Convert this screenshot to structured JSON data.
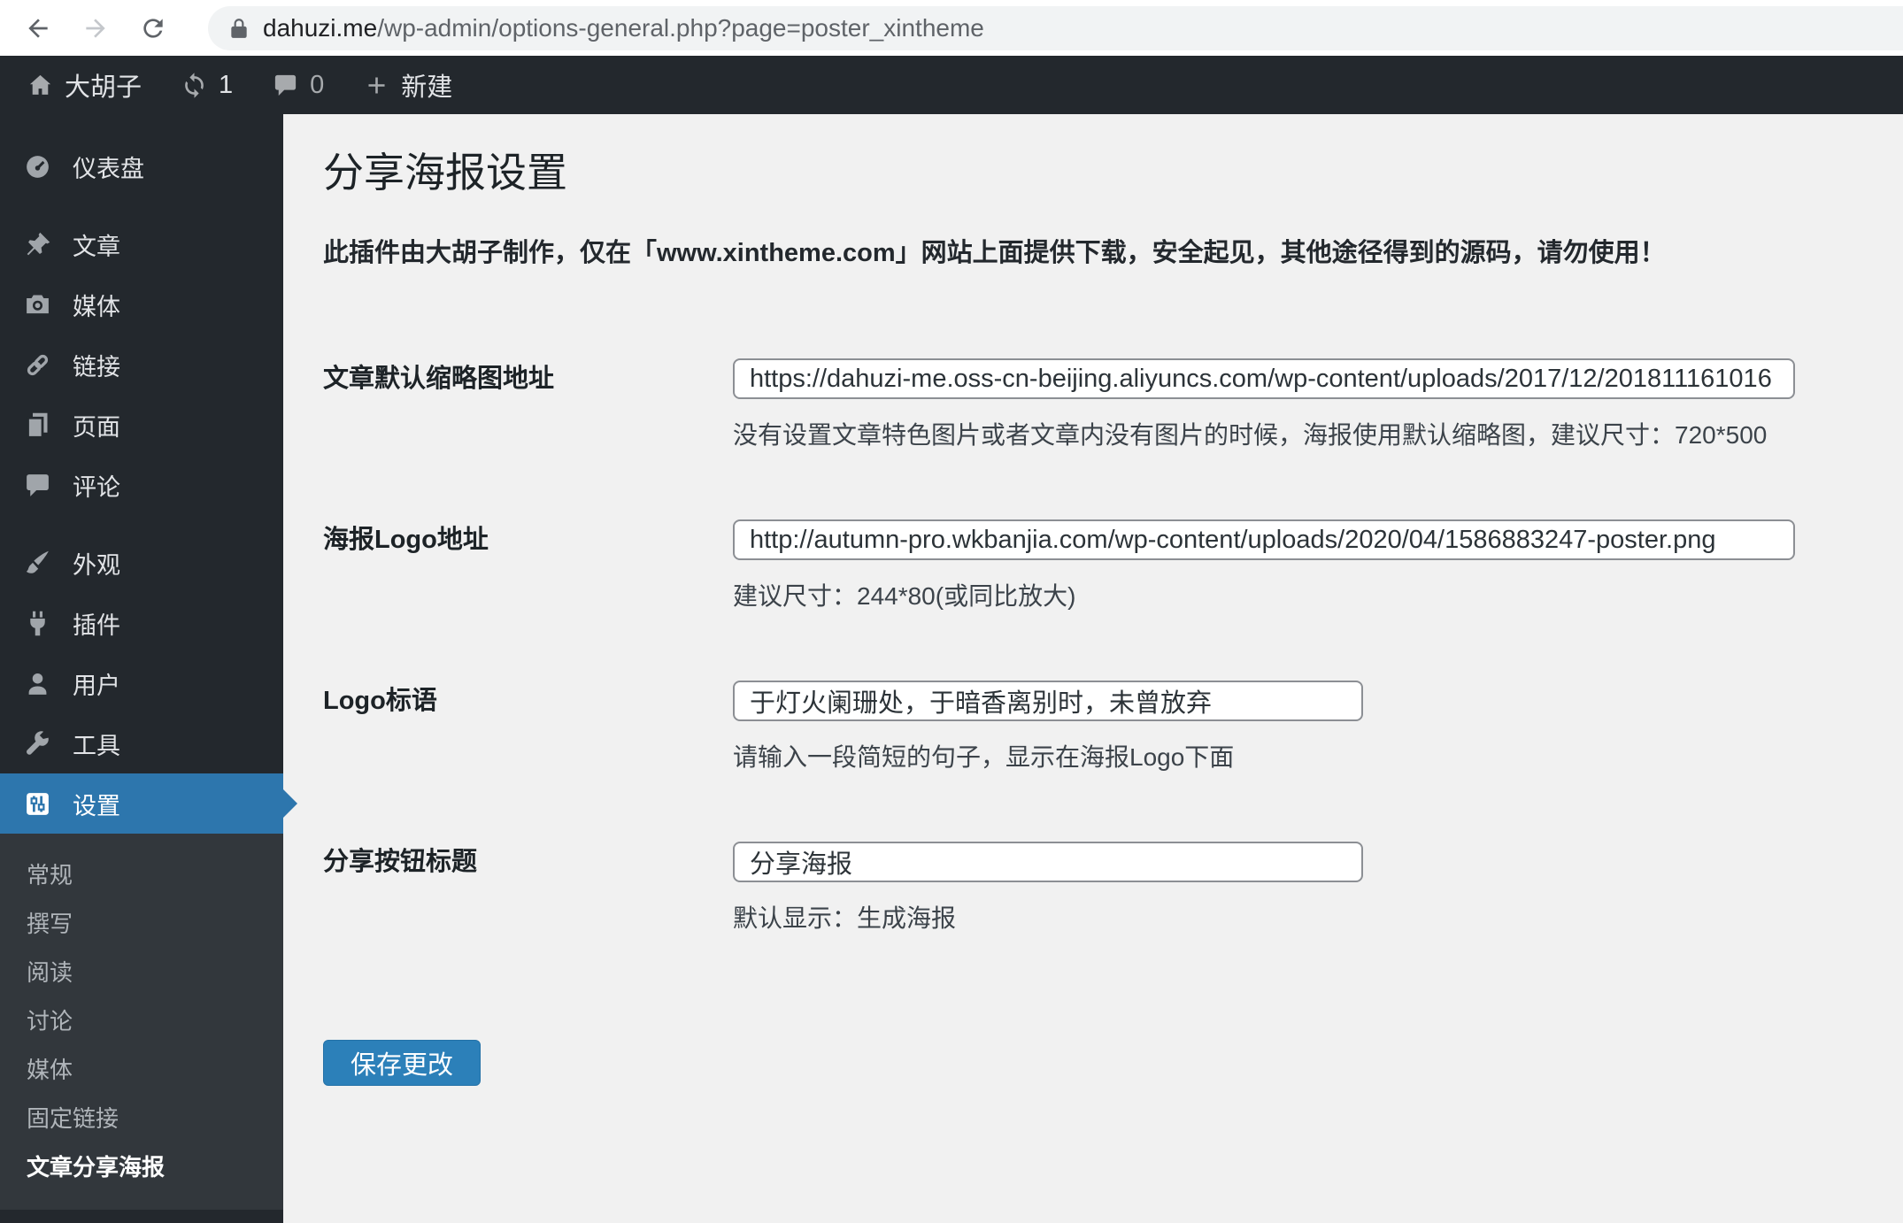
{
  "browser": {
    "url_domain": "dahuzi.me",
    "url_path": "/wp-admin/options-general.php?page=poster_xintheme"
  },
  "admin_bar": {
    "site_name": "大胡子",
    "update_count": "1",
    "comment_count": "0",
    "new_label": "新建"
  },
  "sidebar": {
    "items": [
      {
        "label": "仪表盘",
        "icon": "dashboard-icon"
      },
      {
        "label": "文章",
        "icon": "posts-icon"
      },
      {
        "label": "媒体",
        "icon": "media-icon"
      },
      {
        "label": "链接",
        "icon": "links-icon"
      },
      {
        "label": "页面",
        "icon": "pages-icon"
      },
      {
        "label": "评论",
        "icon": "comments-icon"
      },
      {
        "label": "外观",
        "icon": "appearance-icon"
      },
      {
        "label": "插件",
        "icon": "plugins-icon"
      },
      {
        "label": "用户",
        "icon": "users-icon"
      },
      {
        "label": "工具",
        "icon": "tools-icon"
      },
      {
        "label": "设置",
        "icon": "settings-icon",
        "active": true
      }
    ],
    "submenu": [
      "常规",
      "撰写",
      "阅读",
      "讨论",
      "媒体",
      "固定链接",
      "文章分享海报"
    ],
    "submenu_current": "文章分享海报"
  },
  "main": {
    "title": "分享海报设置",
    "notice": "此插件由大胡子制作，仅在「www.xintheme.com」网站上面提供下载，安全起见，其他途径得到的源码，请勿使用！",
    "fields": [
      {
        "label": "文章默认缩略图地址",
        "value": "https://dahuzi-me.oss-cn-beijing.aliyuncs.com/wp-content/uploads/2017/12/201811161016",
        "help": "没有设置文章特色图片或者文章内没有图片的时候，海报使用默认缩略图，建议尺寸：720*500"
      },
      {
        "label": "海报Logo地址",
        "value": "http://autumn-pro.wkbanjia.com/wp-content/uploads/2020/04/1586883247-poster.png",
        "help": "建议尺寸：244*80(或同比放大)"
      },
      {
        "label": "Logo标语",
        "value": "于灯火阑珊处，于暗香离别时，未曾放弃",
        "help": "请输入一段简短的句子，显示在海报Logo下面"
      },
      {
        "label": "分享按钮标题",
        "value": "分享海报",
        "help": "默认显示：生成海报"
      }
    ],
    "save_label": "保存更改"
  },
  "colors": {
    "accent": "#2d76ad",
    "button": "#2c80b9",
    "admin_bg": "#23282d",
    "submenu_bg": "#32373c"
  }
}
